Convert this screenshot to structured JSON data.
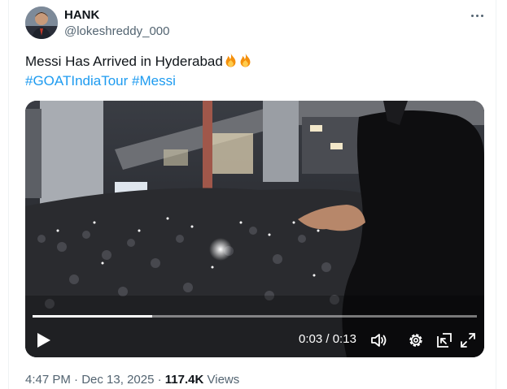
{
  "author": {
    "name": "HANK",
    "handle": "@lokeshreddy_000",
    "avatar_icon": "avatar-photo"
  },
  "more_icon": "more-horizontal-icon",
  "tweet": {
    "text": "Messi Has Arrived in Hyderabad",
    "emoji": [
      "fire",
      "fire"
    ],
    "hashtags": [
      "#GOATIndiaTour",
      "#Messi"
    ]
  },
  "video": {
    "current_time": "0:03",
    "separator": "/",
    "duration": "0:13",
    "progress_fraction": 0.27,
    "controls": [
      "play-icon",
      "volume-icon",
      "settings-gear-icon",
      "pip-icon",
      "fullscreen-icon"
    ]
  },
  "meta": {
    "time": "4:47 PM",
    "dot1": "·",
    "date": "Dec 13, 2025",
    "dot2": "·",
    "views_count": "117.4K",
    "views_label": "Views"
  },
  "colors": {
    "link": "#1d9bf0",
    "text": "#0f1419",
    "secondary": "#536471"
  }
}
